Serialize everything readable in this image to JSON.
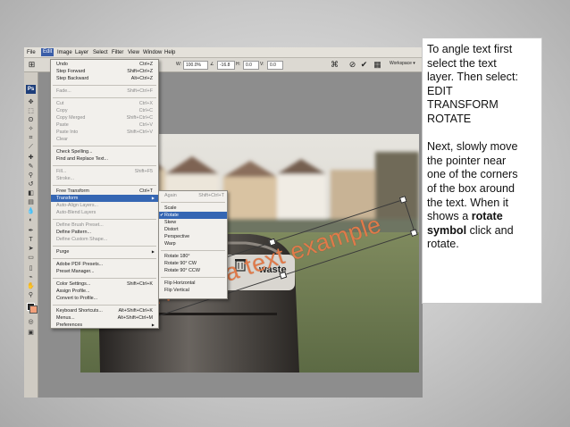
{
  "menubar": {
    "items": [
      "File",
      "Edit",
      "Image",
      "Layer",
      "Select",
      "Filter",
      "View",
      "Window",
      "Help"
    ]
  },
  "options_bar": {
    "w_label": "W:",
    "w_value": "100.0%",
    "angle_value": "-16.8",
    "h_label": "H:",
    "h_value": "0.0",
    "v_label": "V:",
    "v_value": "0.0",
    "workspace_label": "Workspace ▾"
  },
  "toolbox": {
    "logo": "Ps"
  },
  "edit_menu": {
    "items": [
      {
        "label": "Undo",
        "shortcut": "Ctrl+Z"
      },
      {
        "label": "Step Forward",
        "shortcut": "Shift+Ctrl+Z"
      },
      {
        "label": "Step Backward",
        "shortcut": "Alt+Ctrl+Z"
      },
      {
        "label": "Fade...",
        "shortcut": "Shift+Ctrl+F"
      },
      {
        "label": "Cut",
        "shortcut": "Ctrl+X"
      },
      {
        "label": "Copy",
        "shortcut": "Ctrl+C"
      },
      {
        "label": "Copy Merged",
        "shortcut": "Shift+Ctrl+C"
      },
      {
        "label": "Paste",
        "shortcut": "Ctrl+V"
      },
      {
        "label": "Paste Into",
        "shortcut": "Shift+Ctrl+V"
      },
      {
        "label": "Clear",
        "shortcut": ""
      },
      {
        "label": "Check Spelling...",
        "shortcut": ""
      },
      {
        "label": "Find and Replace Text...",
        "shortcut": ""
      },
      {
        "label": "Fill...",
        "shortcut": "Shift+F5"
      },
      {
        "label": "Stroke...",
        "shortcut": ""
      },
      {
        "label": "Free Transform",
        "shortcut": "Ctrl+T"
      },
      {
        "label": "Transform",
        "shortcut": ""
      },
      {
        "label": "Auto-Align Layers...",
        "shortcut": ""
      },
      {
        "label": "Auto-Blend Layers",
        "shortcut": ""
      },
      {
        "label": "Define Brush Preset...",
        "shortcut": ""
      },
      {
        "label": "Define Pattern...",
        "shortcut": ""
      },
      {
        "label": "Define Custom Shape...",
        "shortcut": ""
      },
      {
        "label": "Purge",
        "shortcut": ""
      },
      {
        "label": "Adobe PDF Presets...",
        "shortcut": ""
      },
      {
        "label": "Preset Manager...",
        "shortcut": ""
      },
      {
        "label": "Color Settings...",
        "shortcut": "Shift+Ctrl+K"
      },
      {
        "label": "Assign Profile...",
        "shortcut": ""
      },
      {
        "label": "Convert to Profile...",
        "shortcut": ""
      },
      {
        "label": "Keyboard Shortcuts...",
        "shortcut": "Alt+Shift+Ctrl+K"
      },
      {
        "label": "Menus...",
        "shortcut": "Alt+Shift+Ctrl+M"
      },
      {
        "label": "Preferences",
        "shortcut": ""
      }
    ]
  },
  "transform_menu": {
    "items": [
      {
        "label": "Again",
        "shortcut": "Shift+Ctrl+T"
      },
      {
        "label": "Scale",
        "shortcut": ""
      },
      {
        "label": "Rotate",
        "shortcut": ""
      },
      {
        "label": "Skew",
        "shortcut": ""
      },
      {
        "label": "Distort",
        "shortcut": ""
      },
      {
        "label": "Perspective",
        "shortcut": ""
      },
      {
        "label": "Warp",
        "shortcut": ""
      },
      {
        "label": "Rotate 180°",
        "shortcut": ""
      },
      {
        "label": "Rotate 90° CW",
        "shortcut": ""
      },
      {
        "label": "Rotate 90° CCW",
        "shortcut": ""
      },
      {
        "label": "Flip Horizontal",
        "shortcut": ""
      },
      {
        "label": "Flip Vertical",
        "shortcut": ""
      }
    ]
  },
  "canvas": {
    "bin_label": "waste",
    "rotated_text": "This is a text example",
    "text_color": "#e07a4a"
  },
  "instructions": {
    "para1": [
      "To angle text first",
      "select the text",
      "layer.  Then select:",
      "EDIT",
      "TRANSFORM",
      "ROTATE"
    ],
    "para2_lines": [
      "Next, slowly move",
      "the pointer near",
      "one of the corners",
      "of the box around",
      "the text. When it"
    ],
    "shows_a": "shows a ",
    "bold_rotate": "rotate",
    "bold_symbol": "symbol",
    "click_and": " click and",
    "rotate_end": "rotate."
  }
}
